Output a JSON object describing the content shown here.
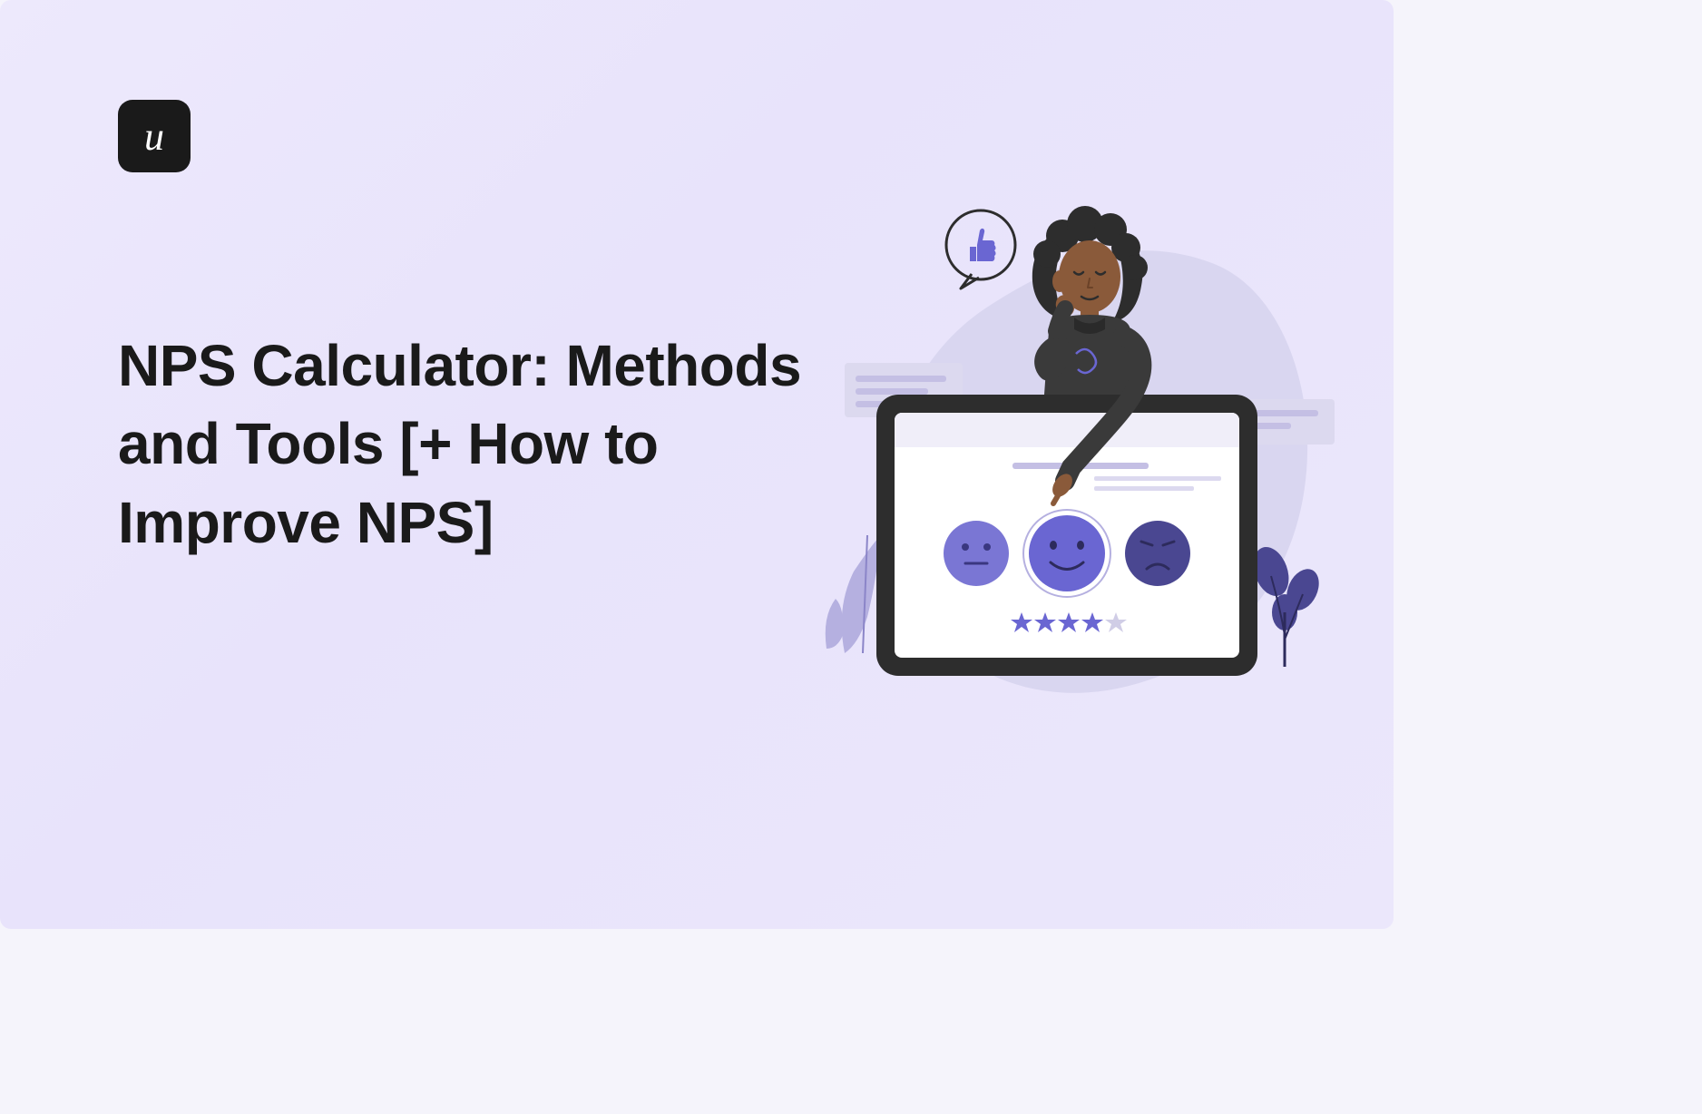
{
  "logo": {
    "letter": "u"
  },
  "title": "NPS Calculator: Methods and Tools [+ How to Improve NPS]",
  "illustration": {
    "rating_stars": 4,
    "total_stars": 5,
    "faces": [
      "neutral",
      "happy",
      "sad"
    ]
  },
  "colors": {
    "background": "#ebe7fb",
    "text": "#1a1a1a",
    "accent": "#6a66d2",
    "accent_dark": "#4a4791"
  }
}
